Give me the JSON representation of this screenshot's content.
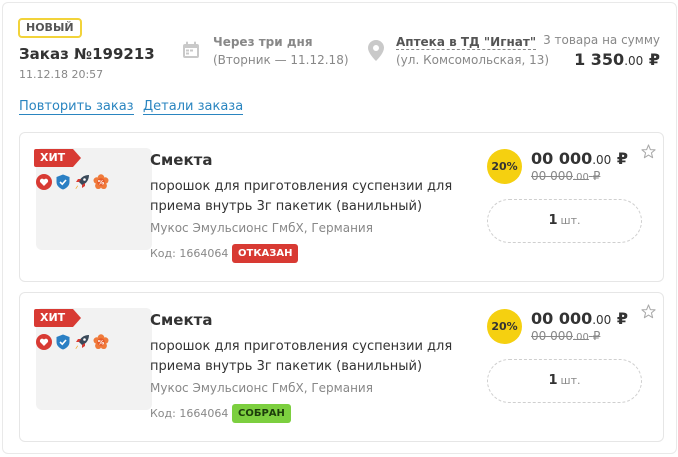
{
  "order": {
    "badge": "НОВЫЙ",
    "title": "Заказ №199213",
    "date": "11.12.18 20:57",
    "delivery_title": "Через три дня",
    "delivery_sub": "(Вторник — 11.12.18)",
    "pharmacy_title": "Аптека в ТД \"Игнат\"",
    "pharmacy_sub": "(ул. Комсомольская, 13)",
    "total_label": "3 товара на сумму",
    "total_rub": "1 350",
    "total_kop": ".00",
    "currency": "₽",
    "repeat_link": "Повторить заказ",
    "details_link": "Детали заказа"
  },
  "items": [
    {
      "hit": "ХИТ",
      "name": "Смекта",
      "description": "порошок для приготовления суспензии для приема внутрь 3г пакетик (ванильный)",
      "manufacturer": "Мукос Эмульсионс ГмбХ, Германия",
      "code": "Код: 1664064",
      "status": "ОТКАЗАН",
      "discount": "20%",
      "price_rub": "00 000",
      "price_kop": ".00",
      "old_price_rub": "00 000",
      "old_price_kop": ".00",
      "currency": "₽",
      "quantity": "1",
      "unit": "шт."
    },
    {
      "hit": "ХИТ",
      "name": "Смекта",
      "description": "порошок для приготовления суспензии для приема внутрь 3г пакетик (ванильный)",
      "manufacturer": "Мукос Эмульсионс ГмбХ, Германия",
      "code": "Код: 1664064",
      "status": "СОБРАН",
      "discount": "20%",
      "price_rub": "00 000",
      "price_kop": ".00",
      "old_price_rub": "00 000",
      "old_price_kop": ".00",
      "currency": "₽",
      "quantity": "1",
      "unit": "шт."
    }
  ],
  "icons": [
    "heart-icon",
    "shield-check-icon",
    "rocket-icon",
    "discount-flower-icon",
    "calendar-icon",
    "location-pin-icon",
    "star-icon"
  ],
  "colors": {
    "link": "#2a85c0",
    "hit": "#d83a33",
    "refused": "#d83a33",
    "collected": "#7ccf3f",
    "discount": "#f5d010",
    "new_badge_border": "#f2d33a"
  }
}
